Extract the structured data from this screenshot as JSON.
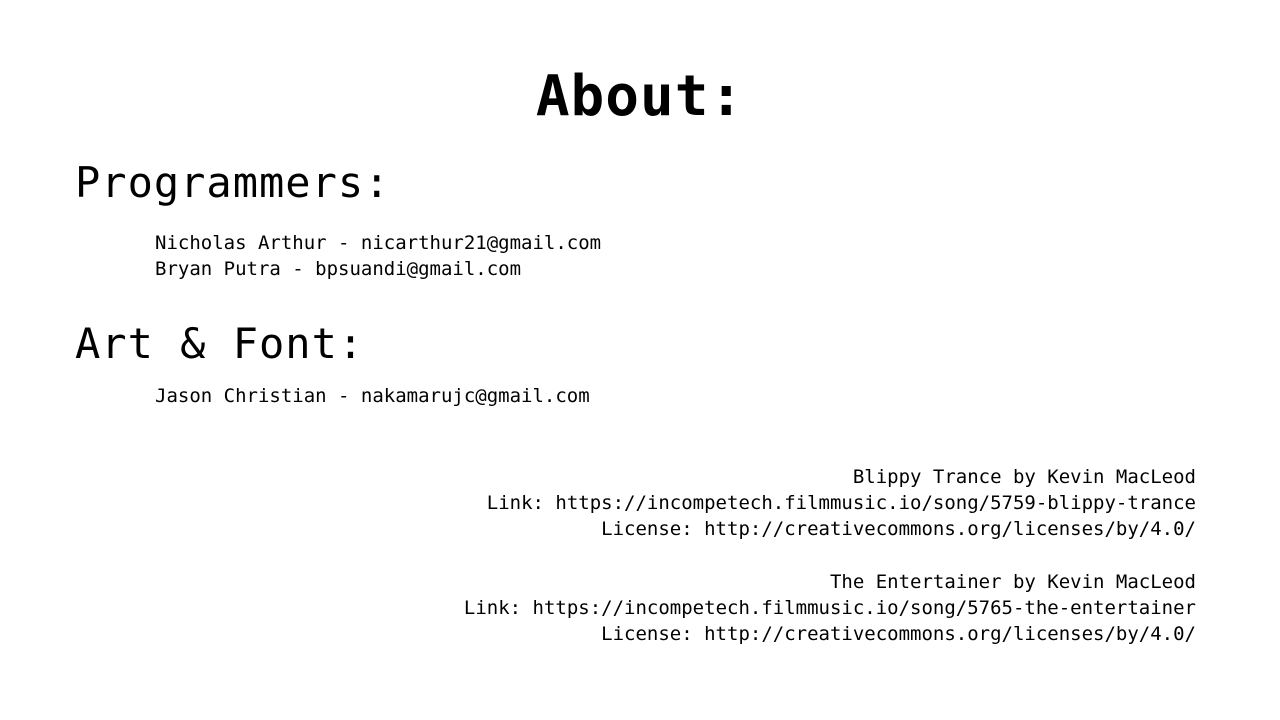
{
  "page": {
    "title": "About:"
  },
  "programmers": {
    "heading": "Programmers:",
    "people": [
      "Nicholas Arthur - nicarthur21@gmail.com",
      "Bryan Putra - bpsuandi@gmail.com"
    ]
  },
  "art_font": {
    "heading": "Art & Font:",
    "people": [
      "Jason Christian - nakamarujc@gmail.com"
    ]
  },
  "music": [
    {
      "title_line": "Blippy Trance by Kevin MacLeod",
      "link_line": "Link: https://incompetech.filmmusic.io/song/5759-blippy-trance",
      "license_line": "License: http://creativecommons.org/licenses/by/4.0/"
    },
    {
      "title_line": "The Entertainer by Kevin MacLeod",
      "link_line": "Link: https://incompetech.filmmusic.io/song/5765-the-entertainer",
      "license_line": "License: http://creativecommons.org/licenses/by/4.0/"
    }
  ],
  "colors": {
    "background": "#ffffff",
    "text": "#000000"
  }
}
